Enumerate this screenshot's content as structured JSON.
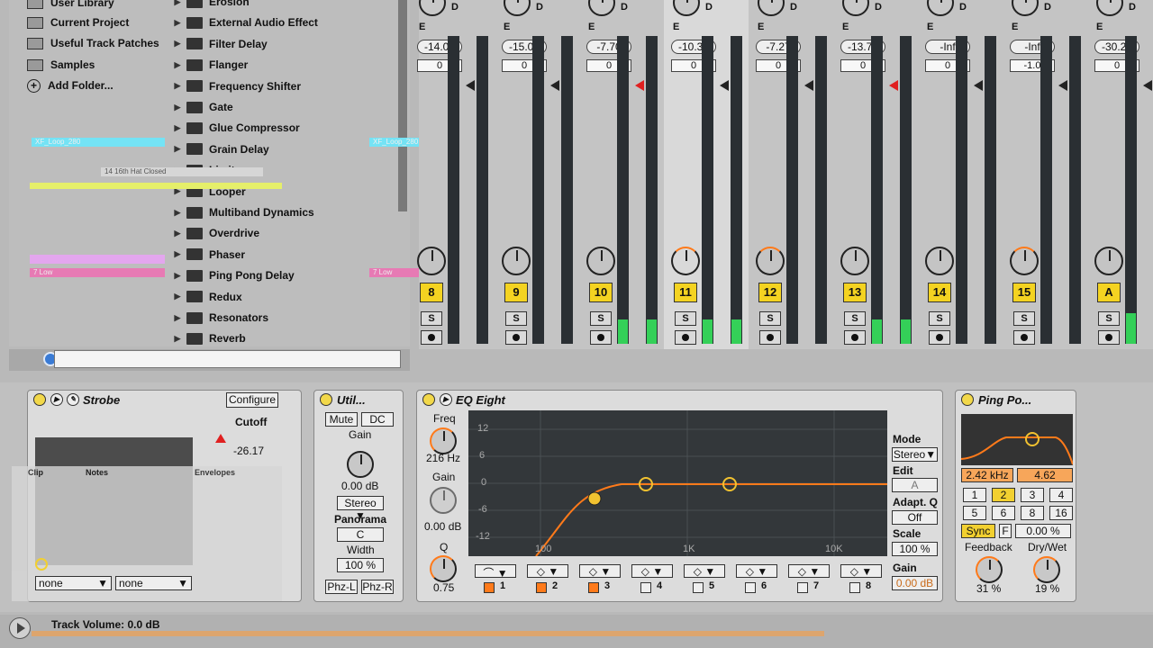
{
  "browser": {
    "places": [
      "User Library",
      "Current Project",
      "Useful Track Patches",
      "Samples",
      "Add Folder..."
    ],
    "effects": [
      "Erosion",
      "External Audio Effect",
      "Filter Delay",
      "Flanger",
      "Frequency Shifter",
      "Gate",
      "Glue Compressor",
      "Grain Delay",
      "Limiter",
      "Looper",
      "Multiband Dynamics",
      "Overdrive",
      "Phaser",
      "Ping Pong Delay",
      "Redux",
      "Resonators",
      "Reverb"
    ]
  },
  "clips": {
    "loop": "XF_Loop_280",
    "hat": "14 16th Hat Closed",
    "low": "7 Low"
  },
  "mixer": {
    "tracks": [
      {
        "num": "8",
        "vol": "-14.01",
        "pan": "0"
      },
      {
        "num": "9",
        "vol": "-15.07",
        "pan": "0"
      },
      {
        "num": "10",
        "vol": "-7.70",
        "pan": "0"
      },
      {
        "num": "11",
        "vol": "-10.34",
        "pan": "0"
      },
      {
        "num": "12",
        "vol": "-7.27",
        "pan": "0"
      },
      {
        "num": "13",
        "vol": "-13.70",
        "pan": "0"
      },
      {
        "num": "14",
        "vol": "-Inf",
        "pan": "0"
      },
      {
        "num": "15",
        "vol": "-Inf",
        "pan": "-1.0"
      },
      {
        "num": "A",
        "vol": "-30.25",
        "pan": "0"
      }
    ],
    "solo_label": "S",
    "send_labels": [
      "D",
      "E"
    ]
  },
  "strobe": {
    "title": "Strobe",
    "configure": "Configure",
    "param_label": "Cutoff",
    "param_value": "-26.17",
    "select1": "none",
    "select2": "none",
    "clip_tabs": [
      "Clip",
      "Notes",
      "Envelopes"
    ]
  },
  "utility": {
    "title": "Util...",
    "mute": "Mute",
    "dc": "DC",
    "gain_label": "Gain",
    "gain_value": "0.00 dB",
    "stereo": "Stereo",
    "panorama_label": "Panorama",
    "panorama_value": "C",
    "width_label": "Width",
    "width_value": "100 %",
    "phz_l": "Phz-L",
    "phz_r": "Phz-R"
  },
  "eq": {
    "title": "EQ Eight",
    "freq_label": "Freq",
    "freq_value": "216 Hz",
    "gain_label": "Gain",
    "gain_value": "0.00 dB",
    "q_label": "Q",
    "q_value": "0.75",
    "y_ticks": [
      "12",
      "6",
      "0",
      "-6",
      "-12"
    ],
    "x_ticks": [
      "100",
      "1K",
      "10K"
    ],
    "bands": [
      "1",
      "2",
      "3",
      "4",
      "5",
      "6",
      "7",
      "8"
    ],
    "mode_label": "Mode",
    "mode_value": "Stereo",
    "edit_label": "Edit",
    "edit_value": "A",
    "adapt_label": "Adapt. Q",
    "adapt_value": "Off",
    "scale_label": "Scale",
    "scale_value": "100 %",
    "out_gain_label": "Gain",
    "out_gain_value": "0.00 dB"
  },
  "pingpong": {
    "title": "Ping Po...",
    "freq": "2.42 kHz",
    "width": "4.62",
    "time_buttons": [
      "1",
      "2",
      "3",
      "4",
      "5",
      "6",
      "8",
      "16"
    ],
    "sync": "Sync",
    "f": "F",
    "offset": "0.00 %",
    "feedback_label": "Feedback",
    "feedback_value": "31 %",
    "drywet_label": "Dry/Wet",
    "drywet_value": "19 %"
  },
  "status": {
    "text": "Track Volume: 0.0 dB"
  },
  "colors": {
    "accent": "#ff7a1a",
    "track_yellow": "#f4d321",
    "meter_green": "#34d058",
    "clip_cyan": "#74e3f5",
    "clip_pink": "#e77ab4"
  }
}
